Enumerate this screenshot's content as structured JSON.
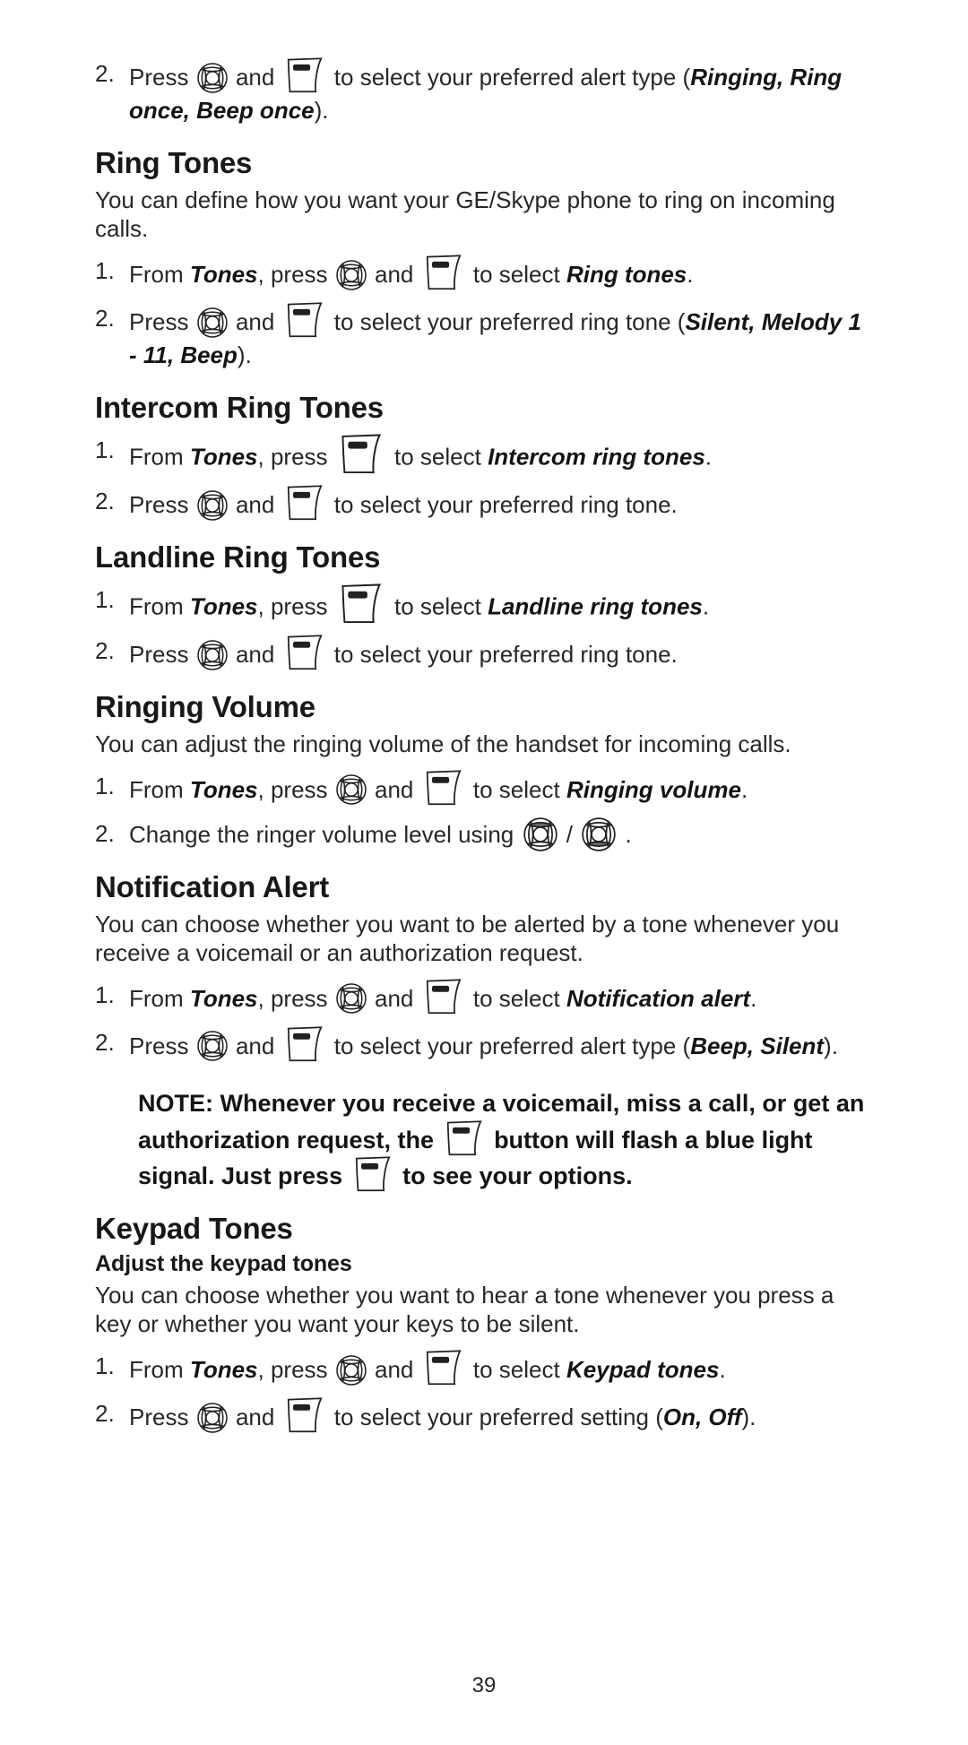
{
  "document": {
    "type": "user-manual-page",
    "page_number": "39",
    "product": "GE/Skype phone"
  },
  "icons": {
    "nav": "navigation-key-icon",
    "nav_up": "navigation-key-up-icon",
    "nav_down": "navigation-key-down-icon",
    "soft": "soft-key-icon"
  },
  "blocks": {
    "step_top": {
      "num": "2.",
      "t1": "Press",
      "t2": "and",
      "t3": "to select your preferred alert type (",
      "b1": "Ringing,",
      "b2": "Ring once, Beep once",
      "t4": ")."
    },
    "ring_tones": {
      "heading": "Ring Tones",
      "intro": "You can define how you want your GE/Skype phone to ring on incoming calls.",
      "step1": {
        "num": "1.",
        "t1": "From",
        "b1": "Tones",
        "t2": ", press",
        "t3": "and",
        "t4": "to select",
        "b2": "Ring tones",
        "t5": "."
      },
      "step2": {
        "num": "2.",
        "t1": "Press",
        "t2": "and",
        "t3": "to select your preferred ring tone (",
        "b1": "Silent,",
        "b2": "Melody 1 - 11, Beep",
        "t4": ")."
      }
    },
    "intercom_ring_tones": {
      "heading": "Intercom Ring Tones",
      "step1": {
        "num": "1.",
        "t1": "From",
        "b1": "Tones",
        "t2": ", press",
        "t3": "to select",
        "b2": "Intercom ring tones",
        "t4": "."
      },
      "step2": {
        "num": "2.",
        "t1": "Press",
        "t2": "and",
        "t3": "to select your preferred ring tone."
      }
    },
    "landline_ring_tones": {
      "heading": "Landline Ring Tones",
      "step1": {
        "num": "1.",
        "t1": "From",
        "b1": "Tones",
        "t2": ", press",
        "t3": "to select",
        "b2": "Landline ring tones",
        "t4": "."
      },
      "step2": {
        "num": "2.",
        "t1": "Press",
        "t2": "and",
        "t3": "to select your preferred ring tone."
      }
    },
    "ringing_volume": {
      "heading": "Ringing Volume",
      "intro": "You can adjust the ringing volume of the handset for incoming calls.",
      "step1": {
        "num": "1.",
        "t1": "From",
        "b1": "Tones",
        "t2": ", press",
        "t3": "and",
        "t4": "to select",
        "b2": "Ringing volume",
        "t5": "."
      },
      "step2": {
        "num": "2.",
        "t1": "Change the ringer volume level using",
        "sep": "/",
        "t2": "."
      }
    },
    "notification_alert": {
      "heading": "Notification Alert",
      "intro": "You can choose whether you want to be alerted by a tone whenever you receive a voicemail or an authorization request.",
      "step1": {
        "num": "1.",
        "t1": "From",
        "b1": "Tones",
        "t2": ", press",
        "t3": "and",
        "t4": "to select",
        "b2": "Notification alert",
        "t5": "."
      },
      "step2": {
        "num": "2.",
        "t1": "Press",
        "t2": "and",
        "t3": "to select your preferred alert type (",
        "b1": "Beep,",
        "b2": "Silent",
        "t4": ")."
      },
      "note": {
        "t1": "NOTE: Whenever you receive a voicemail, miss a call, or get an authorization request, the",
        "t2": "button will flash a blue light signal. Just press",
        "t3": "to see your options."
      }
    },
    "keypad_tones": {
      "heading": "Keypad Tones",
      "subheading": "Adjust the keypad tones",
      "intro": "You can choose whether you want to hear a tone whenever you press a key or whether you want your keys to be silent.",
      "step1": {
        "num": "1.",
        "t1": "From",
        "b1": "Tones",
        "t2": ", press",
        "t3": "and",
        "t4": "to select",
        "b2": "Keypad tones",
        "t5": "."
      },
      "step2": {
        "num": "2.",
        "t1": "Press",
        "t2": "and",
        "t3": "to select your preferred setting (",
        "b1": "On, Off",
        "t4": ")."
      }
    }
  }
}
